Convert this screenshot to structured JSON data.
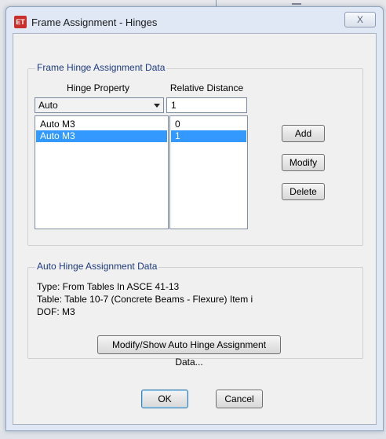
{
  "window": {
    "title": "Frame Assignment - Hinges",
    "app_icon_label": "ET",
    "close_symbol": "X"
  },
  "frame_group": {
    "title": "Frame Hinge Assignment Data",
    "col_hinge_property": "Hinge Property",
    "col_relative_distance": "Relative Distance",
    "hinge_property_selected": "Auto",
    "relative_distance_value": "1",
    "rows": [
      {
        "hinge": "Auto  M3",
        "distance": "0",
        "selected": false
      },
      {
        "hinge": "Auto  M3",
        "distance": "1",
        "selected": true
      }
    ],
    "add_label": "Add",
    "modify_label": "Modify",
    "delete_label": "Delete"
  },
  "auto_group": {
    "title": "Auto Hinge Assignment Data",
    "type_line": "Type:  From Tables In ASCE 41-13",
    "table_line": "Table:  Table 10-7 (Concrete Beams - Flexure) Item i",
    "dof_line": "DOF:  M3",
    "modify_show_label": "Modify/Show Auto Hinge Assignment Data..."
  },
  "footer": {
    "ok_label": "OK",
    "cancel_label": "Cancel"
  },
  "colors": {
    "selection": "#3399ff",
    "group_title": "#1d3a80",
    "title_icon": "#c9302c"
  }
}
